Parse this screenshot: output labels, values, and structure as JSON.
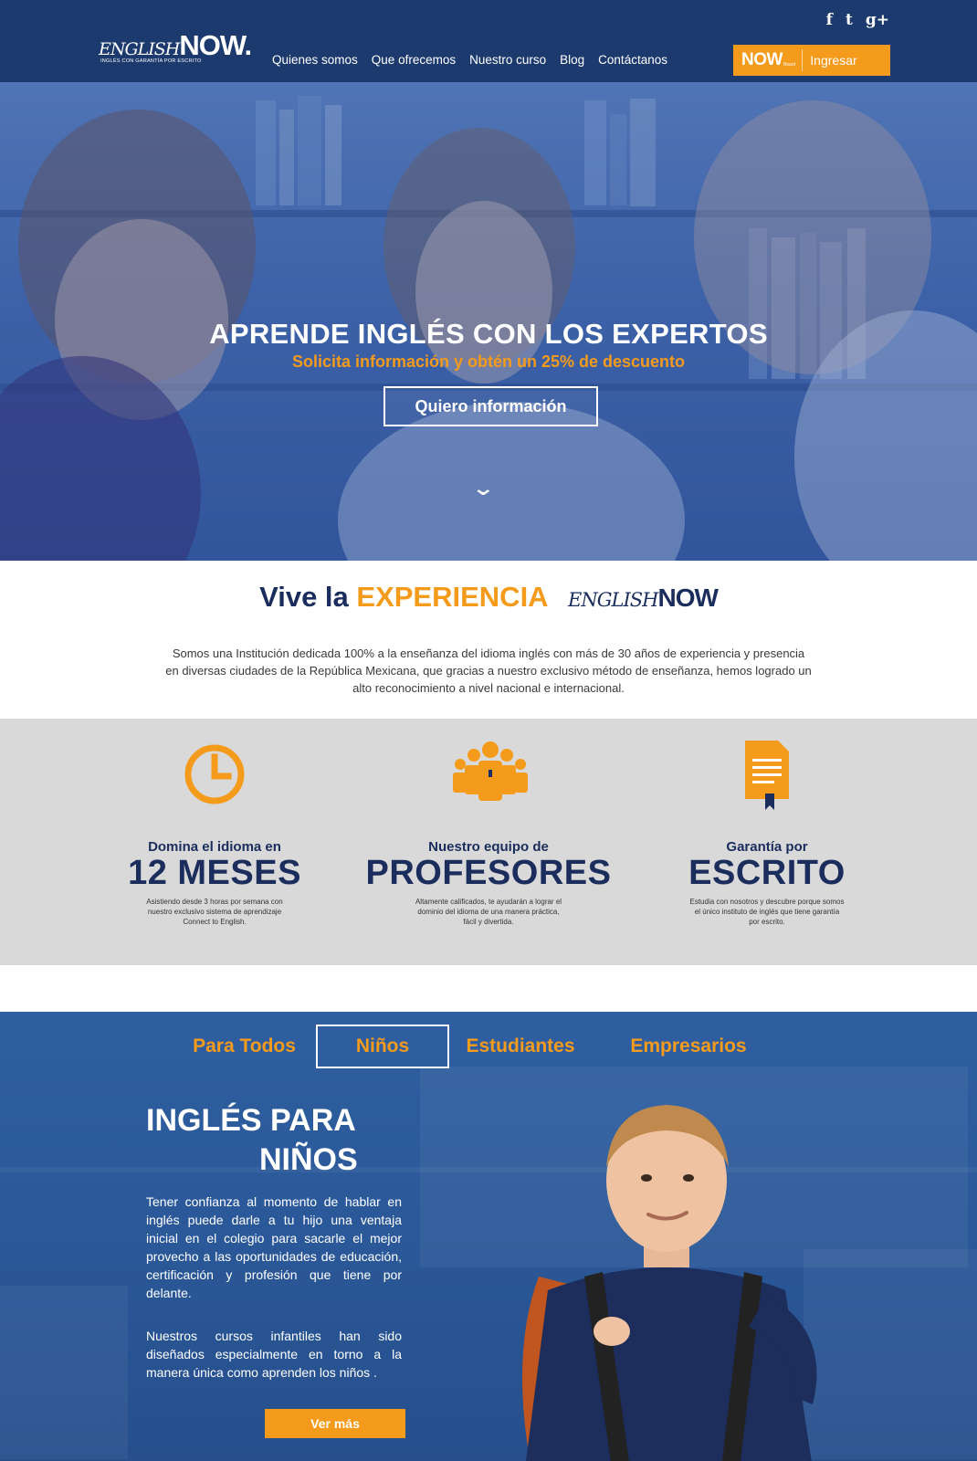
{
  "header": {
    "social": [
      "f",
      "t",
      "g+"
    ],
    "logo": {
      "english": "ENGLISH",
      "now": "NOW.",
      "tagline": "INGLÉS CON GARANTÍA POR ESCRITO"
    },
    "nav": [
      "Quienes somos",
      "Que ofrecemos",
      "Nuestro curso",
      "Blog",
      "Contáctanos"
    ],
    "login": {
      "brand": "NOW",
      "brand_small": "Board",
      "label": "Ingresar"
    }
  },
  "hero": {
    "title": "APRENDE INGLÉS CON LOS EXPERTOS",
    "subtitle": "Solicita información y obtén un 25% de descuento",
    "button": "Quiero información",
    "scroll_icon": "chevron-down-icon"
  },
  "experience": {
    "title_prefix": "Vive la",
    "title_highlight": "EXPERIENCIA",
    "logo_english": "ENGLISH",
    "logo_now": "NOW",
    "text": "Somos una Institución dedicada 100% a la enseñanza del idioma inglés con más de 30 años de experiencia y presencia en diversas ciudades de la República Mexicana, que gracias a nuestro exclusivo método de enseñanza, hemos logrado un alto reconocimiento a nivel nacional e internacional."
  },
  "features": [
    {
      "icon": "clock-icon",
      "small": "Domina el idioma en",
      "big": "12 MESES",
      "desc": "Asistiendo desde 3 horas por semana con nuestro exclusivo sistema de aprendizaje Connect to English."
    },
    {
      "icon": "team-icon",
      "small": "Nuestro equipo de",
      "big": "PROFESORES",
      "desc": "Altamente calificados, te ayudarán a lograr el dominio del idioma de una manera práctica, fácil y divertida."
    },
    {
      "icon": "certificate-icon",
      "small": "Garantía por",
      "big": "ESCRITO",
      "desc": "Estudia con nosotros y descubre porque somos el único instituto de inglés que tiene garantía por escrito."
    }
  ],
  "kids": {
    "tabs": [
      "Para Todos",
      "Niños",
      "Estudiantes",
      "Empresarios"
    ],
    "active_tab": "Niños",
    "title_line1": "INGLÉS PARA",
    "title_line2": "NIÑOS",
    "paragraph1": "Tener confianza al momento de hablar en inglés puede darle a tu hijo una ventaja inicial en el colegio para sacarle el mejor provecho a las oportunidades de educación, certificación y profesión que tiene por delante.",
    "paragraph2": "Nuestros cursos infantiles han sido diseñados especialmente en torno a la manera única como aprenden los niños .",
    "button": "Ver más"
  },
  "colors": {
    "navy": "#1d3a6e",
    "orange": "#f59b1c",
    "hero_blue": "#4d71b4",
    "gray": "#d9d9d9",
    "kids_blue": "#2a5797"
  }
}
